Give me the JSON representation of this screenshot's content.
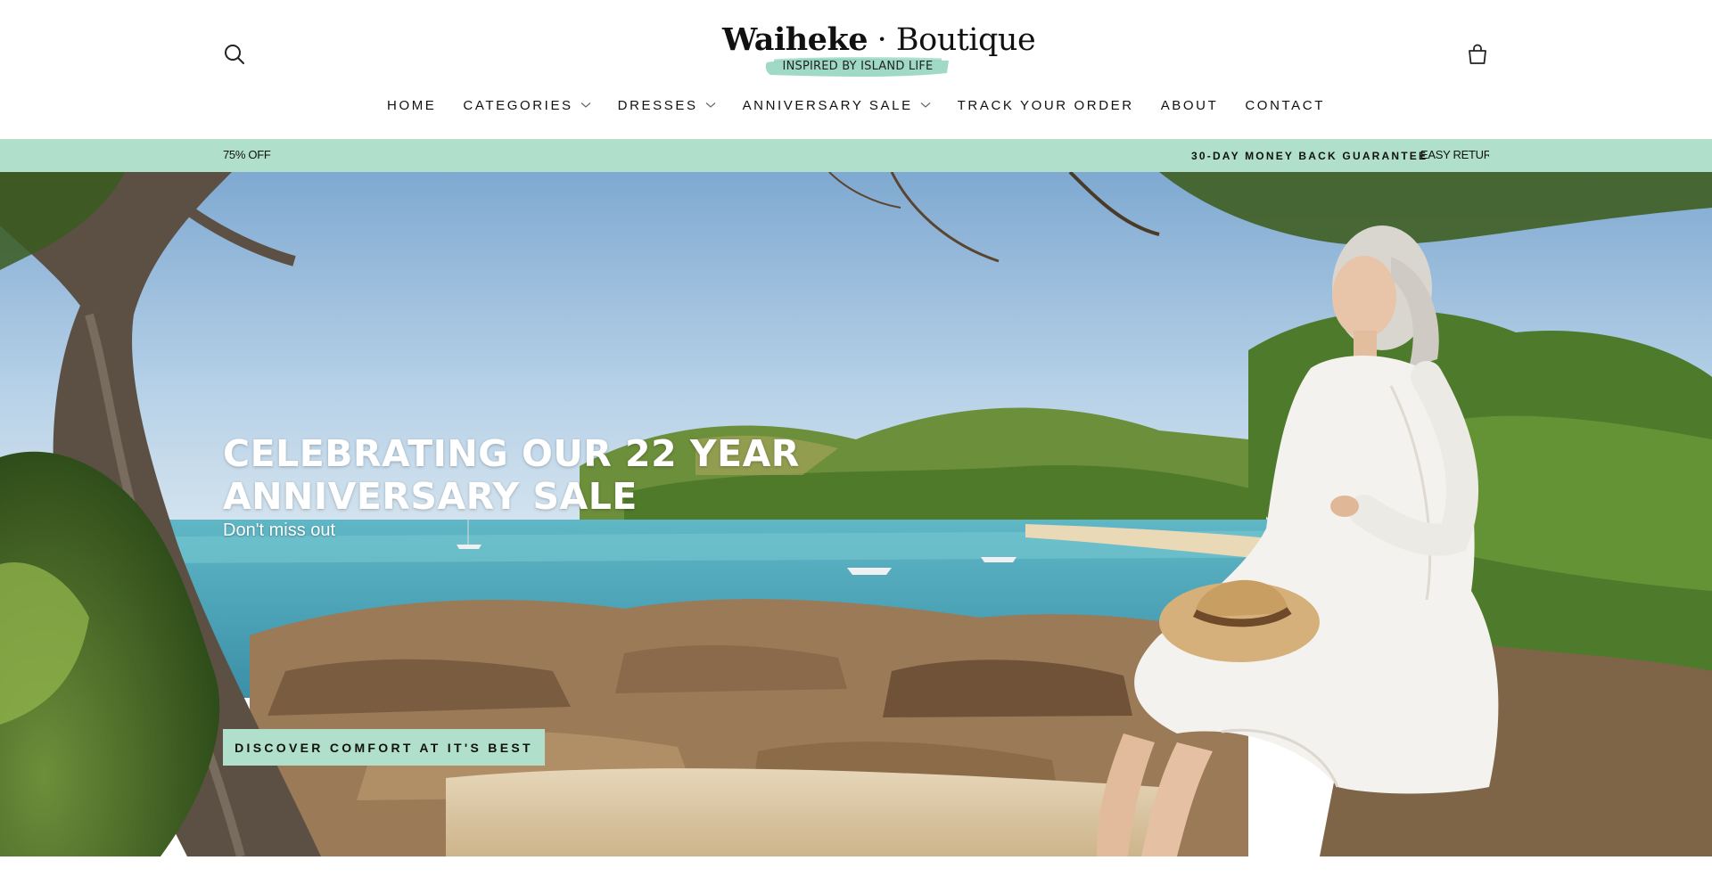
{
  "brand": {
    "name_part1": "Waiheke",
    "separator": "·",
    "name_part2": "Boutique",
    "tagline": "INSPIRED BY ISLAND LIFE",
    "tagline_brush_color": "#8fd3bd"
  },
  "header": {
    "search_icon": "search-icon",
    "cart_icon": "cart-icon"
  },
  "nav": {
    "items": [
      {
        "label": "HOME",
        "dropdown": false
      },
      {
        "label": "CATEGORIES",
        "dropdown": true
      },
      {
        "label": "DRESSES",
        "dropdown": true
      },
      {
        "label": "ANNIVERSARY SALE",
        "dropdown": true
      },
      {
        "label": "TRACK YOUR ORDER",
        "dropdown": false
      },
      {
        "label": "ABOUT",
        "dropdown": false
      },
      {
        "label": "CONTACT",
        "dropdown": false
      }
    ]
  },
  "announcement": {
    "left_text": "75% OFF",
    "right_text_1": "30-DAY MONEY BACK GUARANTEE",
    "right_text_2": "EASY RETURNS",
    "bg_color": "#b0e0cb"
  },
  "hero": {
    "title_line1": "CELEBRATING OUR 22 YEAR",
    "title_line2": "ANNIVERSARY SALE",
    "subtitle": "Don't miss out",
    "button_label": "DISCOVER COMFORT AT IT'S BEST",
    "button_color": "#b0e0cb"
  }
}
